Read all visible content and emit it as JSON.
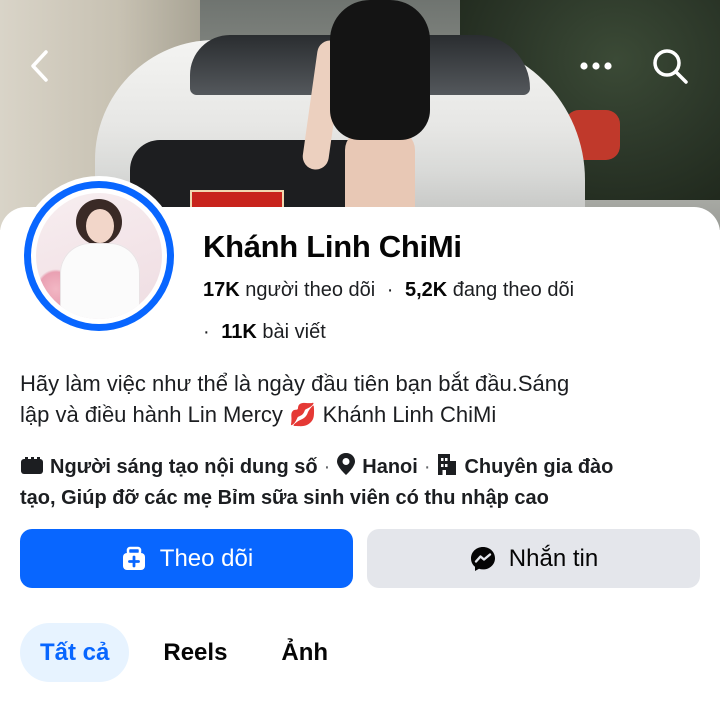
{
  "header": {
    "back_icon": "chevron-left-icon",
    "more_icon": "more-horizontal-icon",
    "search_icon": "search-icon"
  },
  "profile": {
    "name": "Khánh Linh ChiMi",
    "followers_count": "17K",
    "followers_label": "người theo dõi",
    "following_count": "5,2K",
    "following_label": "đang theo dõi",
    "posts_count": "11K",
    "posts_label": "bài viết",
    "bio_line1": "Hãy làm việc như thể là ngày đầu tiên bạn bắt đầu.Sáng",
    "bio_line2": "lập và điều hành Lin Mercy",
    "bio_emoji": "💋",
    "bio_line2_end": "Khánh Linh ChiMi",
    "category": "Người sáng tạo nội dung số",
    "location": "Hanoi",
    "job_line1": "Chuyên gia đào",
    "job_line2": "tạo, Giúp đỡ các mẹ Bỉm sữa sinh viên có thu nhập cao"
  },
  "actions": {
    "follow_label": "Theo dõi",
    "message_label": "Nhắn tin"
  },
  "tabs": [
    {
      "label": "Tất cả",
      "active": true
    },
    {
      "label": "Reels",
      "active": false
    },
    {
      "label": "Ảnh",
      "active": false
    }
  ],
  "colors": {
    "accent": "#0866ff",
    "tab_active_bg": "#e7f3ff",
    "secondary_button": "#e4e6eb"
  }
}
